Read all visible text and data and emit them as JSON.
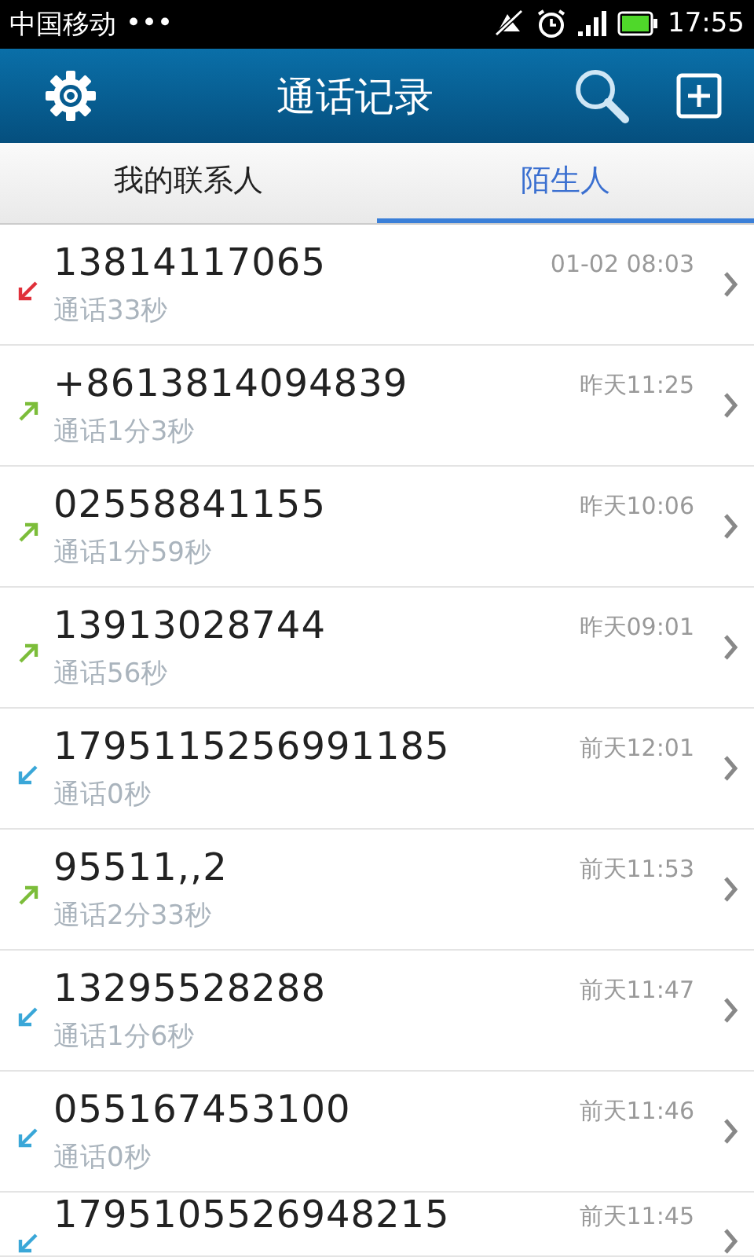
{
  "status_bar": {
    "carrier": "中国移动",
    "dots": "•••",
    "time": "17:55"
  },
  "header": {
    "title": "通话记录"
  },
  "tabs": [
    {
      "label": "我的联系人",
      "selected": false
    },
    {
      "label": "陌生人",
      "selected": true
    }
  ],
  "calls": [
    {
      "kind": "missed",
      "number": "13814117065",
      "duration": "通话33秒",
      "time": "01-02 08:03"
    },
    {
      "kind": "outgoing",
      "number": "+8613814094839",
      "duration": "通话1分3秒",
      "time": "昨天11:25"
    },
    {
      "kind": "outgoing",
      "number": "02558841155",
      "duration": "通话1分59秒",
      "time": "昨天10:06"
    },
    {
      "kind": "outgoing",
      "number": "13913028744",
      "duration": "通话56秒",
      "time": "昨天09:01"
    },
    {
      "kind": "incoming",
      "number": "1795115256991185",
      "duration": "通话0秒",
      "time": "前天12:01"
    },
    {
      "kind": "outgoing",
      "number": "95511,,2",
      "duration": "通话2分33秒",
      "time": "前天11:53"
    },
    {
      "kind": "incoming",
      "number": "13295528288",
      "duration": "通话1分6秒",
      "time": "前天11:47"
    },
    {
      "kind": "incoming",
      "number": "055167453100",
      "duration": "通话0秒",
      "time": "前天11:46"
    },
    {
      "kind": "incoming",
      "number": "1795105526948215",
      "time": "前天11:45"
    }
  ]
}
